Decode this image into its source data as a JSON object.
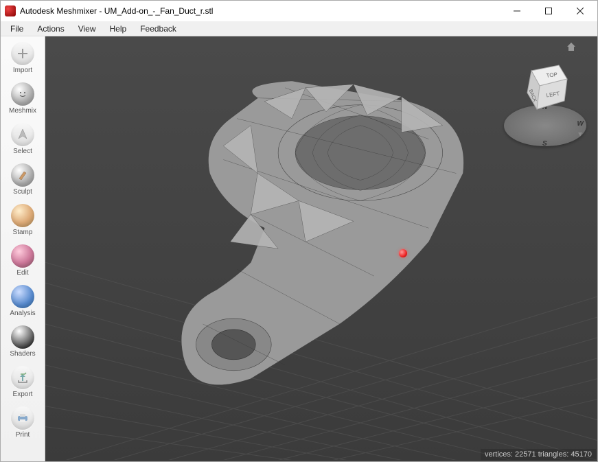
{
  "window": {
    "title": "Autodesk Meshmixer - UM_Add-on_-_Fan_Duct_r.stl"
  },
  "menubar": {
    "file": "File",
    "actions": "Actions",
    "view": "View",
    "help": "Help",
    "feedback": "Feedback"
  },
  "sidebar": {
    "import": "Import",
    "meshmix": "Meshmix",
    "select": "Select",
    "sculpt": "Sculpt",
    "stamp": "Stamp",
    "edit": "Edit",
    "analysis": "Analysis",
    "shaders": "Shaders",
    "export": "Export",
    "print": "Print"
  },
  "navcube": {
    "top": "TOP",
    "back": "BACK",
    "left": "LEFT",
    "north": "N",
    "west": "W",
    "south": "S"
  },
  "status": {
    "vertices_label": "vertices:",
    "vertices": "22571",
    "triangles_label": "triangles:",
    "triangles": "45170"
  }
}
